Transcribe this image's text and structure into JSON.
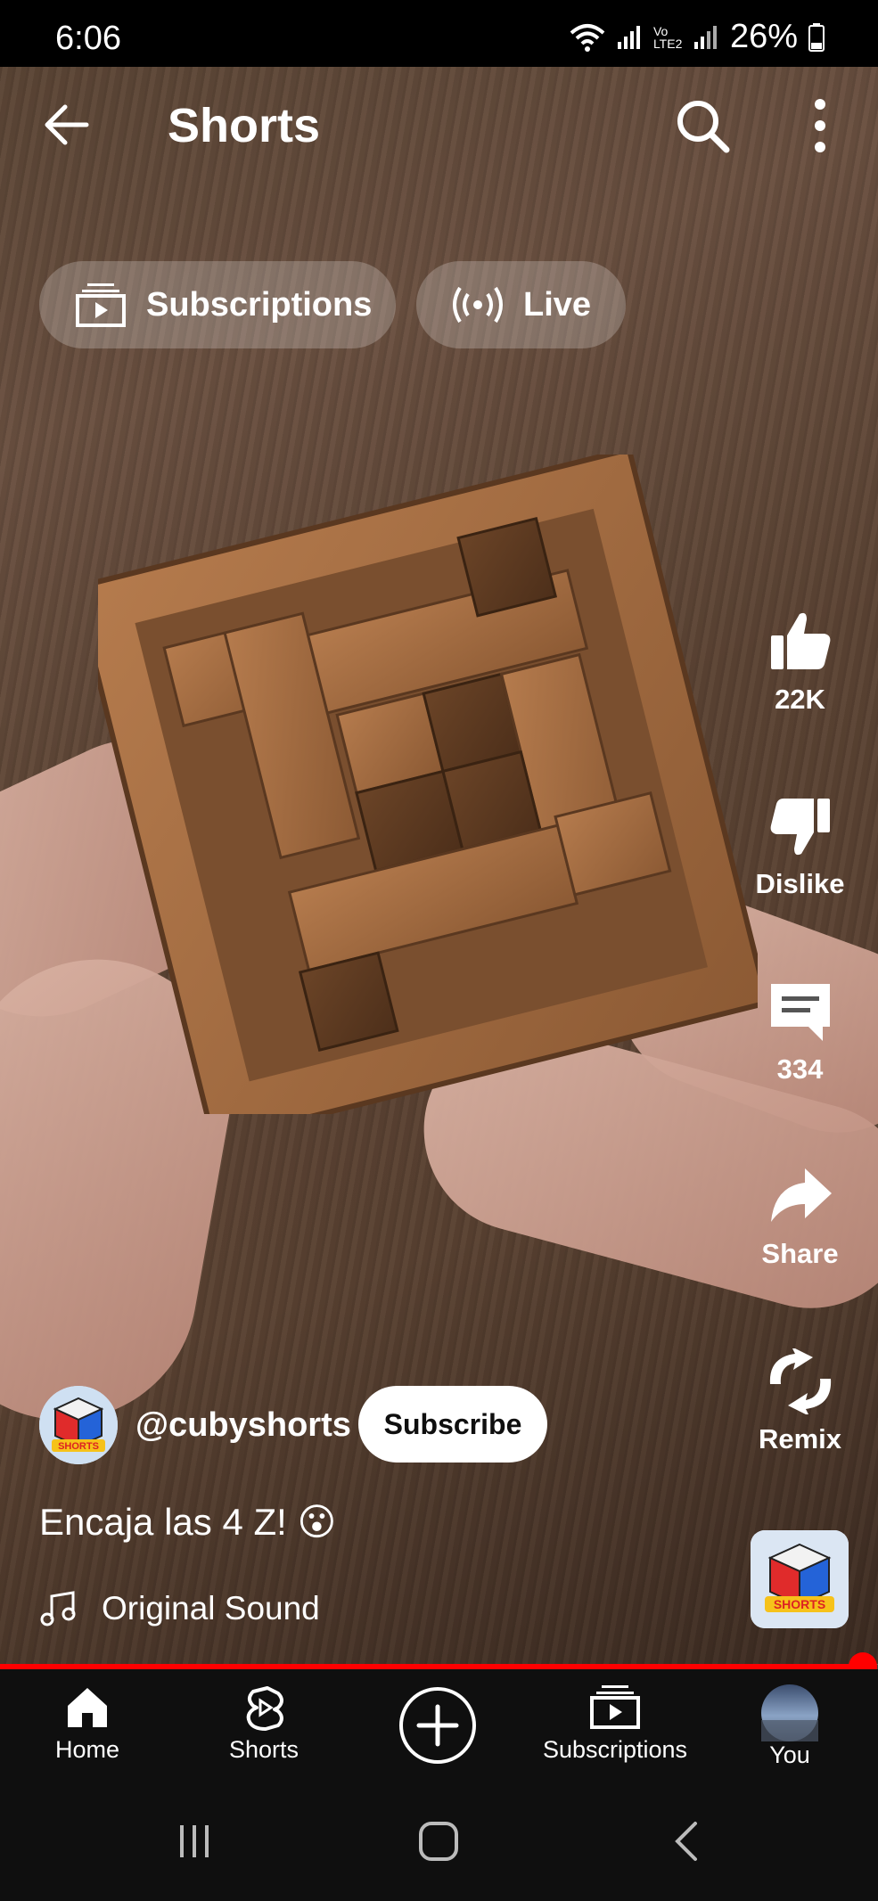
{
  "status_bar": {
    "time": "6:06",
    "volte_label": "Vo LTE2",
    "battery": "26%"
  },
  "header": {
    "title": "Shorts"
  },
  "chips": [
    {
      "label": "Subscriptions",
      "icon": "subscriptions-icon"
    },
    {
      "label": "Live",
      "icon": "live-icon"
    }
  ],
  "actions": {
    "like_count": "22K",
    "dislike_label": "Dislike",
    "comment_count": "334",
    "share_label": "Share",
    "remix_label": "Remix"
  },
  "channel": {
    "handle": "@cubyshorts",
    "subscribe_label": "Subscribe",
    "logo_text": "SHORTS"
  },
  "video": {
    "caption": "Encaja las 4 Z! 😮",
    "sound": "Original Sound",
    "progress": 0.97
  },
  "bottom_nav": [
    {
      "label": "Home",
      "icon": "home-icon"
    },
    {
      "label": "Shorts",
      "icon": "shorts-icon"
    },
    {
      "label": "",
      "icon": "create-icon"
    },
    {
      "label": "Subscriptions",
      "icon": "subscriptions-icon"
    },
    {
      "label": "You",
      "icon": "avatar"
    }
  ],
  "colors": {
    "accent": "#ff0000",
    "nav_bg": "#0f0f0f"
  }
}
